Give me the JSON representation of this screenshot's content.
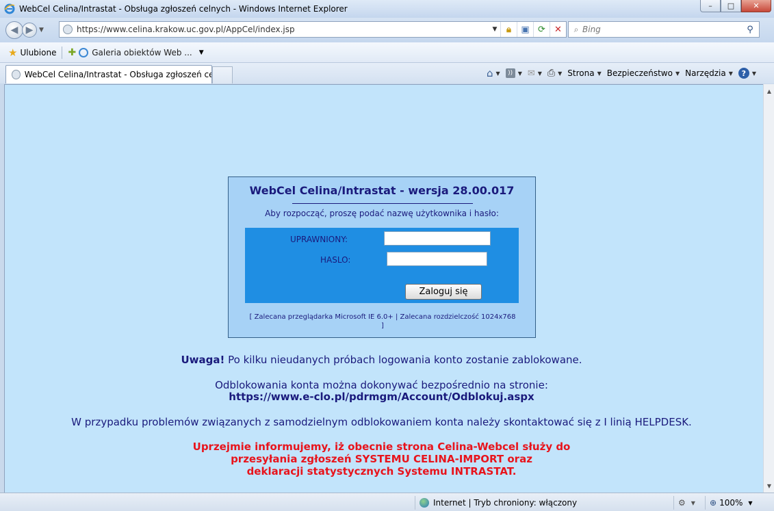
{
  "window": {
    "title": "WebCel Celina/Intrastat - Obsługa zgłoszeń celnych - Windows Internet Explorer",
    "minimize": "–",
    "maximize": "□",
    "close": "✕"
  },
  "address": {
    "url": "https://www.celina.krakow.uc.gov.pl/AppCel/index.jsp"
  },
  "search": {
    "placeholder": "Bing"
  },
  "favorites": {
    "label": "Ulubione",
    "gallery": "Galeria obiektów Web ..."
  },
  "tab": {
    "label": "WebCel Celina/Intrastat - Obsługa zgłoszeń celny..."
  },
  "commandbar": {
    "page": "Strona",
    "safety": "Bezpieczeństwo",
    "tools": "Narzędzia"
  },
  "login": {
    "heading": "WebCel Celina/Intrastat - wersja 28.00.017",
    "subtitle": "Aby rozpocząć, proszę podać nazwę użytkownika i hasło:",
    "user_label": "UPRAWNIONY:",
    "user_value": "",
    "pass_label": "HASLO:",
    "pass_value": "",
    "submit": "Zaloguj się",
    "recommendation": "[ Zalecana przeglądarka Microsoft IE 6.0+ | Zalecana rozdzielczość 1024x768 ]"
  },
  "messages": {
    "warn_bold": "Uwaga!",
    "warn_text": " Po kilku nieudanych próbach logowania konto zostanie zablokowane.",
    "unlock_line1": "Odblokowania konta można dokonywać bezpośrednio na stronie:",
    "unlock_line2": "https://www.e-clo.pl/pdrmgm/Account/Odblokuj.aspx",
    "helpdesk": "W przypadku problemów związanych z samodzielnym odblokowaniem konta należy skontaktować się z I linią HELPDESK.",
    "red1": "Uprzejmie informujemy, iż obecnie strona Celina-Webcel służy do",
    "red2": "przesyłania zgłoszeń SYSTEMU CELINA-IMPORT oraz",
    "red3": "deklaracji statystycznych Systemu INTRASTAT."
  },
  "status": {
    "zone": "Internet | Tryb chroniony: włączony",
    "zoom": "100%"
  }
}
